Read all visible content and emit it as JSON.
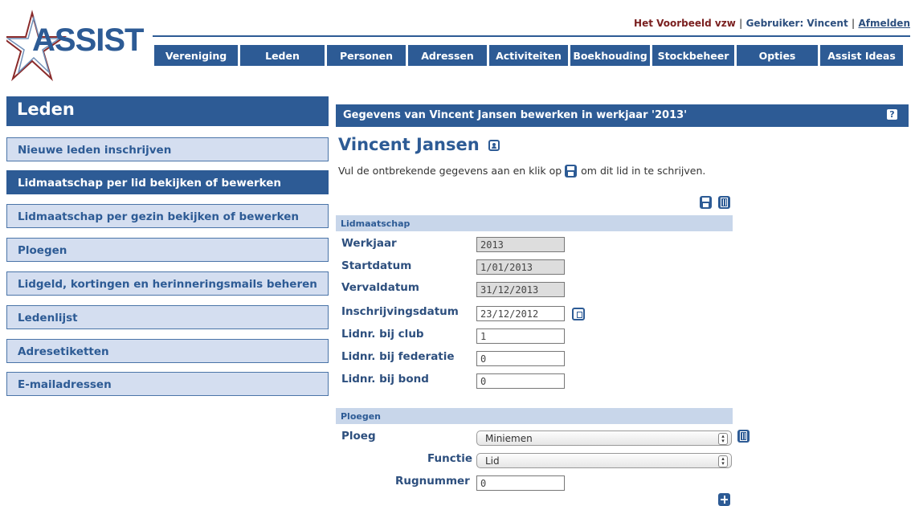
{
  "header": {
    "organization": "Het Voorbeeld vzw",
    "separator": "|",
    "user_label": "Gebruiker: Vincent",
    "logout": "Afmelden",
    "logo_text": "ASSIST"
  },
  "nav": [
    {
      "label": "Vereniging"
    },
    {
      "label": "Leden"
    },
    {
      "label": "Personen"
    },
    {
      "label": "Adressen"
    },
    {
      "label": "Activiteiten"
    },
    {
      "label": "Boekhouding"
    },
    {
      "label": "Stockbeheer"
    },
    {
      "label": "Opties"
    },
    {
      "label": "Assist Ideas"
    }
  ],
  "sidebar": {
    "title": "Leden",
    "items": [
      {
        "label": "Nieuwe leden inschrijven"
      },
      {
        "label": "Lidmaatschap per lid bekijken of bewerken"
      },
      {
        "label": "Lidmaatschap per gezin bekijken of bewerken"
      },
      {
        "label": "Ploegen"
      },
      {
        "label": "Lidgeld, kortingen en herinneringsmails beheren"
      },
      {
        "label": "Ledenlijst"
      },
      {
        "label": "Adresetiketten"
      },
      {
        "label": "E-mailadressen"
      }
    ]
  },
  "main": {
    "header": "Gegevens van Vincent Jansen bewerken in werkjaar '2013'",
    "help": "?",
    "person_name": "Vincent Jansen",
    "instruction_before": "Vul de ontbrekende gegevens aan en klik op",
    "instruction_after": "om dit lid in te schrijven.",
    "section_lidmaatschap": "Lidmaatschap",
    "fields": {
      "werkjaar": {
        "label": "Werkjaar",
        "value": "2013"
      },
      "startdatum": {
        "label": "Startdatum",
        "value": "1/01/2013"
      },
      "vervaldatum": {
        "label": "Vervaldatum",
        "value": "31/12/2013"
      },
      "inschrijvingsdatum": {
        "label": "Inschrijvingsdatum",
        "value": "23/12/2012"
      },
      "lidnr_club": {
        "label": "Lidnr. bij club",
        "value": "1"
      },
      "lidnr_federatie": {
        "label": "Lidnr. bij federatie",
        "value": "0"
      },
      "lidnr_bond": {
        "label": "Lidnr. bij bond",
        "value": "0"
      }
    },
    "section_ploegen": "Ploegen",
    "ploeg": {
      "label": "Ploeg",
      "value": "Miniemen"
    },
    "functie": {
      "label": "Functie",
      "value": "Lid"
    },
    "rugnummer": {
      "label": "Rugnummer",
      "value": "0"
    }
  },
  "icons": {
    "save": "save-icon",
    "delete": "trash-icon",
    "calendar": "calendar-icon",
    "add": "plus-icon",
    "person": "person-icon"
  },
  "colors": {
    "primary": "#2d5b95",
    "sidebar_item_bg": "#d4def0",
    "section_bg": "#c8d6ea",
    "org_text": "#7a2020"
  }
}
